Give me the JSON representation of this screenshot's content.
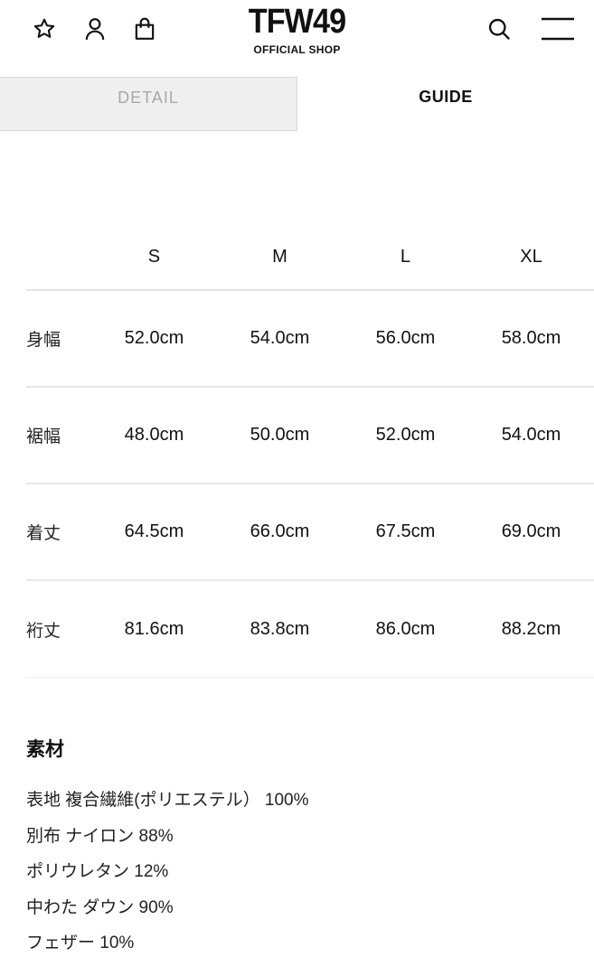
{
  "header": {
    "logo_main": "TFW49",
    "logo_sub": "OFFICIAL SHOP",
    "icons": [
      "star-icon",
      "user-icon",
      "shopping-bag-icon",
      "search-icon",
      "menu-icon"
    ]
  },
  "tabs": [
    {
      "label": "DETAIL",
      "active": false
    },
    {
      "label": "GUIDE",
      "active": true
    }
  ],
  "size_table": {
    "columns": [
      "S",
      "M",
      "L",
      "XL"
    ],
    "rows": [
      {
        "label": "身幅",
        "values": [
          "52.0cm",
          "54.0cm",
          "56.0cm",
          "58.0cm"
        ]
      },
      {
        "label": "裾幅",
        "values": [
          "48.0cm",
          "50.0cm",
          "52.0cm",
          "54.0cm"
        ]
      },
      {
        "label": "着丈",
        "values": [
          "64.5cm",
          "66.0cm",
          "67.5cm",
          "69.0cm"
        ]
      },
      {
        "label": "裄丈",
        "values": [
          "81.6cm",
          "83.8cm",
          "86.0cm",
          "88.2cm"
        ]
      }
    ]
  },
  "material": {
    "title": "素材",
    "lines": [
      "表地 複合繊維(ポリエステル） 100%",
      "別布 ナイロン 88%",
      "ポリウレタン 12%",
      "中わた ダウン 90%",
      "フェザー 10%"
    ]
  }
}
